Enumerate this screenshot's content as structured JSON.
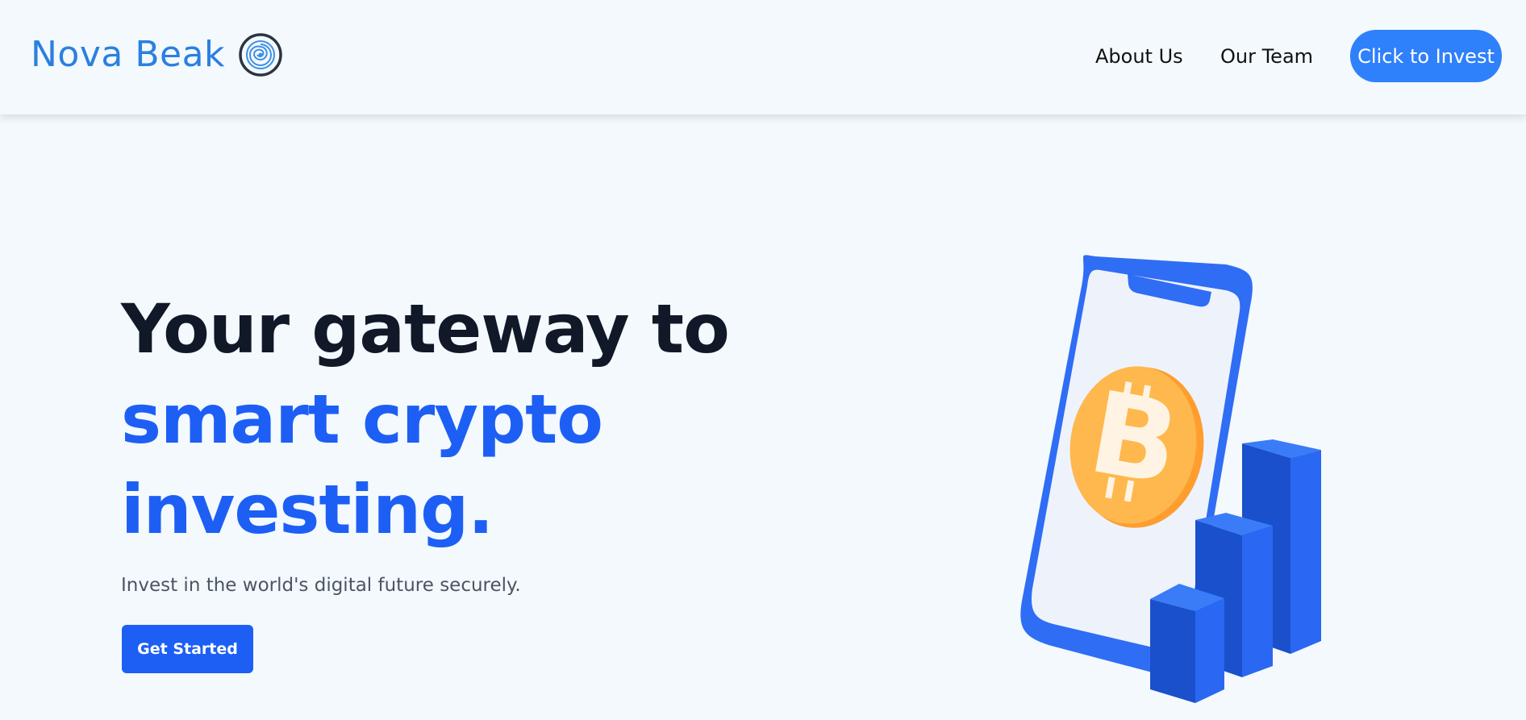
{
  "header": {
    "brand_name": "Nova Beak",
    "logo_icon": "spiral-target-icon",
    "nav": {
      "about": "About Us",
      "team": "Our Team"
    },
    "invest_button": "Click to Invest"
  },
  "hero": {
    "headline_line1": "Your gateway to",
    "headline_line2": "smart crypto",
    "headline_line3": "investing.",
    "subtitle": "Invest in the world's digital future securely.",
    "cta": "Get Started",
    "illustration_icons": [
      "smartphone-icon",
      "bitcoin-coin-icon",
      "bar-chart-icon"
    ]
  },
  "colors": {
    "background": "#f3f9fd",
    "brand": "#2b7fe0",
    "accent": "#1d5ff5",
    "button": "#2f80fb",
    "headline": "#111827",
    "coin": "#ffb74d"
  }
}
